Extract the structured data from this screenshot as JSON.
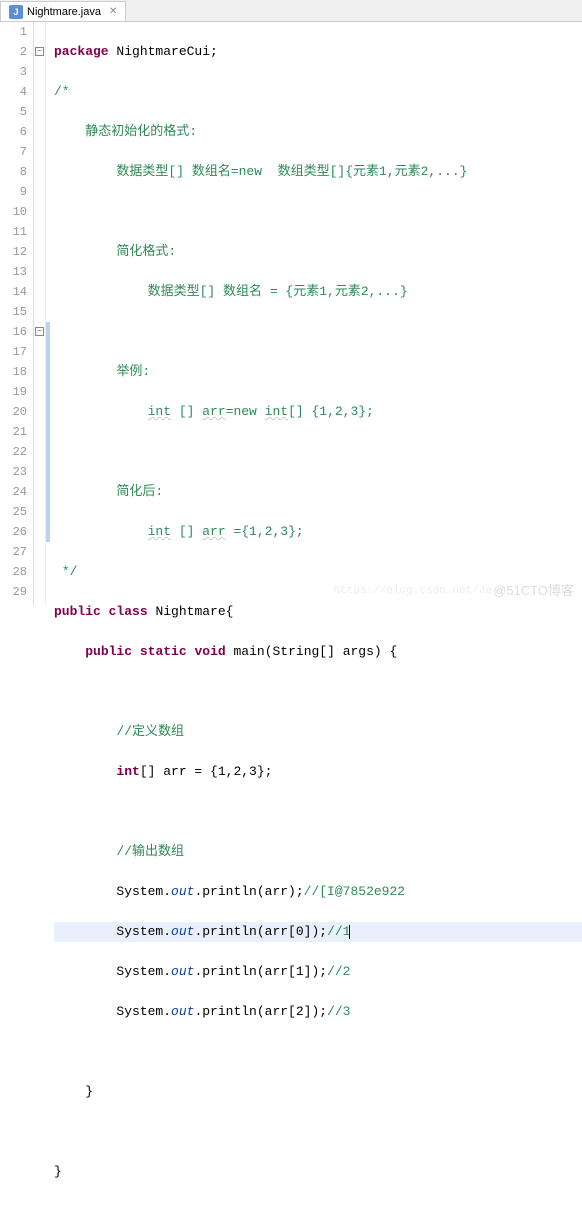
{
  "tab": {
    "icon_letter": "J",
    "title": "Nightmare.java",
    "close": "✕"
  },
  "code": {
    "l1_kw": "package",
    "l1_rest": " NightmareCui;",
    "l2": "/*",
    "l3": "    静态初始化的格式:",
    "l4": "        数据类型[] 数组名=new  数组类型[]{元素1,元素2,...}",
    "l5": "",
    "l6": "        简化格式:",
    "l7": "            数据类型[] 数组名 = {元素1,元素2,...}",
    "l8": "",
    "l9": "        举例:",
    "l10a": "            ",
    "l10_int": "int",
    "l10b": " [] ",
    "l10_arr": "arr",
    "l10c": "=new ",
    "l10_int2": "int",
    "l10d": "[] {1,2,3};",
    "l11": "",
    "l12": "        简化后:",
    "l13a": "            ",
    "l13_int": "int",
    "l13b": " [] ",
    "l13_arr": "arr",
    "l13c": " ={1,2,3};",
    "l14": " */",
    "l15_pub": "public",
    "l15_cls": "class",
    "l15_name": " Nightmare{",
    "l16_pub": "public",
    "l16_stat": "static",
    "l16_void": "void",
    "l16_main": " main(String[] args) {",
    "l17": "",
    "l18": "//定义数组",
    "l19_int": "int",
    "l19_rest": "[] arr = {1,2,3};",
    "l20": "",
    "l21": "//输出数组",
    "l22a": "System.",
    "l22b": "out",
    "l22c": ".println(arr);",
    "l22d": "//[I@7852e922",
    "l23a": "System.",
    "l23b": "out",
    "l23c": ".println(arr[0]);",
    "l23d": "//1",
    "l24a": "System.",
    "l24b": "out",
    "l24c": ".println(arr[1]);",
    "l24d": "//2",
    "l25a": "System.",
    "l25b": "out",
    "l25c": ".println(arr[2]);",
    "l25d": "//3",
    "l26": "",
    "l27": "    }",
    "l28": "",
    "l29": "}"
  },
  "line_numbers": [
    "1",
    "2",
    "3",
    "4",
    "5",
    "6",
    "7",
    "8",
    "9",
    "10",
    "11",
    "12",
    "13",
    "14",
    "15",
    "16",
    "17",
    "18",
    "19",
    "20",
    "21",
    "22",
    "23",
    "24",
    "25",
    "26",
    "27",
    "28",
    "29"
  ],
  "watermark_main": "@51CTO博客",
  "watermark_sub": "https://blog.csdn.net/Ja"
}
